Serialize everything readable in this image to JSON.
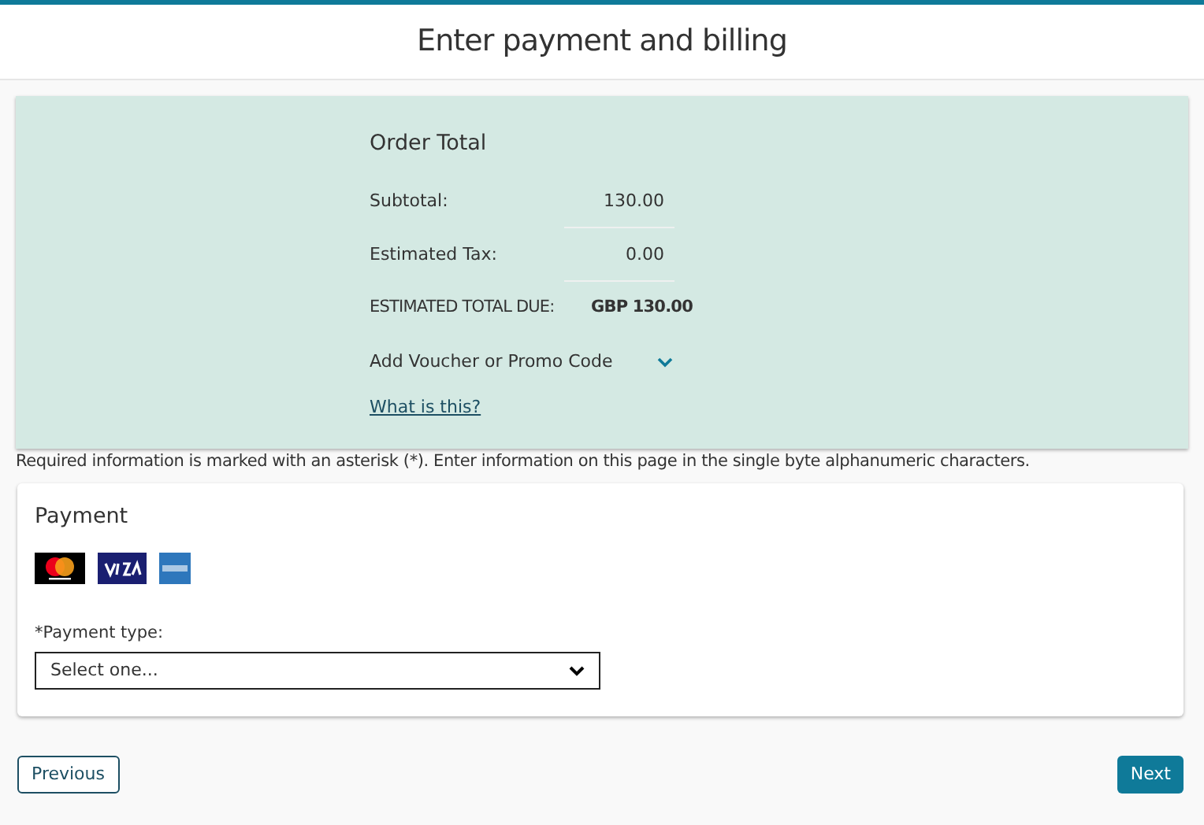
{
  "header": {
    "title": "Enter payment and billing"
  },
  "order_total": {
    "title": "Order Total",
    "rows": [
      {
        "kind": "line",
        "label": "Subtotal:",
        "value": "130.00"
      },
      {
        "kind": "line",
        "label": "Estimated Tax:",
        "value": "0.00"
      },
      {
        "kind": "total",
        "label": "ESTIMATED TOTAL DUE:",
        "value": "GBP 130.00"
      }
    ],
    "voucher": {
      "label": "Add Voucher or Promo Code",
      "expanded": false
    },
    "help_link": "What is this?"
  },
  "notice": "Required information is marked with an asterisk (*). Enter information on this page in the single byte alphanumeric characters.",
  "payment": {
    "title": "Payment",
    "cards": [
      {
        "kind": "mastercard"
      },
      {
        "kind": "visa"
      },
      {
        "kind": "amex"
      }
    ],
    "payment_type": {
      "label": "*Payment type:",
      "value": "Select one..."
    }
  },
  "buttons": [
    {
      "kind": "secondary",
      "label": "Previous"
    },
    {
      "kind": "primary",
      "label": "Next"
    }
  ]
}
